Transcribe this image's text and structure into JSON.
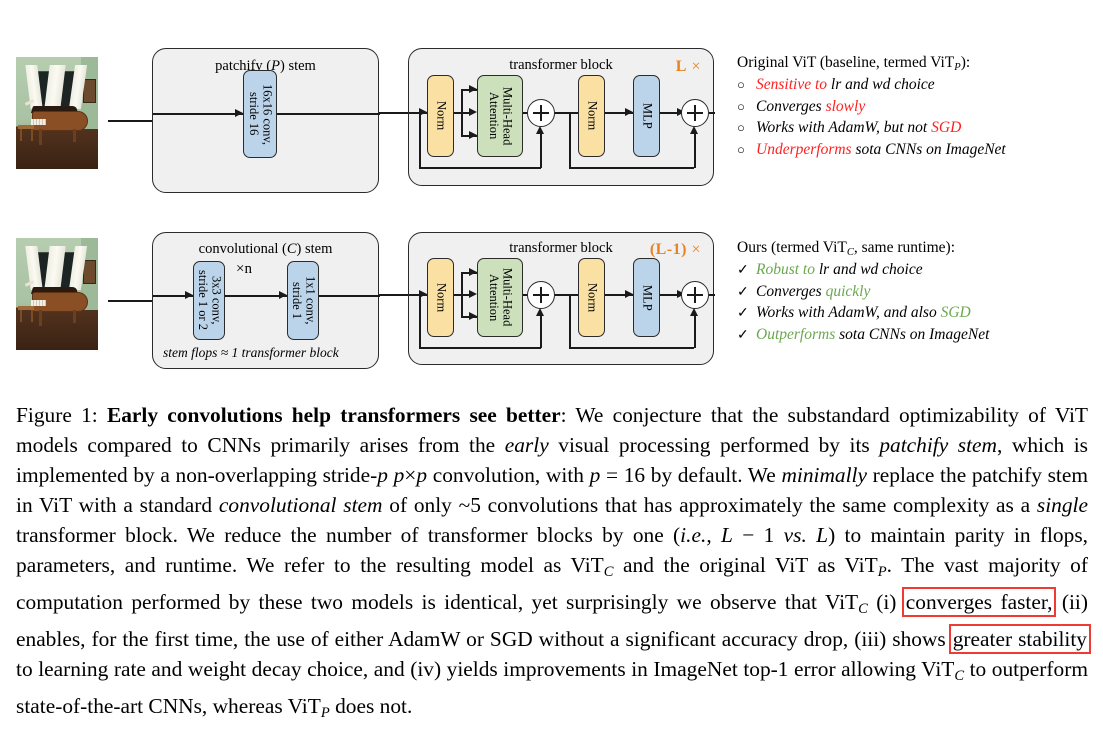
{
  "figure": {
    "rows": [
      {
        "id": "row-original",
        "stem": {
          "title_pre": "patchify (",
          "title_sym": "P",
          "title_post": ") stem",
          "blocks": [
            {
              "label": "16x16 conv,\nstride 16"
            }
          ]
        },
        "transformer": {
          "title": "transformer block",
          "repeat": "L",
          "repeat_x": "×",
          "nodes": [
            "Norm",
            "Multi-Head\nAttention",
            "+",
            "Norm",
            "MLP",
            "+"
          ]
        },
        "panel": {
          "head_pre": "Original ViT (baseline, termed ViT",
          "head_sub": "P",
          "head_post": "):",
          "marker": "○",
          "bullets": [
            {
              "parts": [
                {
                  "t": "Sensitive to",
                  "c": "red"
                },
                {
                  "t": " lr and wd choice",
                  "c": "black"
                }
              ]
            },
            {
              "parts": [
                {
                  "t": "Converges ",
                  "c": "black"
                },
                {
                  "t": "slowly",
                  "c": "red"
                }
              ]
            },
            {
              "parts": [
                {
                  "t": "Works with AdamW, but not ",
                  "c": "black"
                },
                {
                  "t": "SGD",
                  "c": "red"
                }
              ]
            },
            {
              "parts": [
                {
                  "t": "Underperforms",
                  "c": "red"
                },
                {
                  "t": " sota CNNs on ImageNet",
                  "c": "black"
                }
              ]
            }
          ]
        }
      },
      {
        "id": "row-ours",
        "stem": {
          "title_pre": "convolutional (",
          "title_sym": "C",
          "title_post": ") stem",
          "blocks": [
            {
              "label": "3x3 conv,\nstride 1 or 2"
            },
            {
              "label": "1x1 conv,\nstride 1"
            }
          ],
          "multiplier": "×n",
          "note": "stem flops ≈ 1 transformer block"
        },
        "transformer": {
          "title": "transformer block",
          "repeat": "(L-1)",
          "repeat_x": "×",
          "nodes": [
            "Norm",
            "Multi-Head\nAttention",
            "+",
            "Norm",
            "MLP",
            "+"
          ]
        },
        "panel": {
          "head_pre": "Ours (termed ViT",
          "head_sub": "C",
          "head_post": ", same runtime):",
          "marker": "✓",
          "bullets": [
            {
              "parts": [
                {
                  "t": "Robust to",
                  "c": "green"
                },
                {
                  "t": " lr and wd choice",
                  "c": "black"
                }
              ]
            },
            {
              "parts": [
                {
                  "t": "Converges ",
                  "c": "black"
                },
                {
                  "t": "quickly",
                  "c": "green"
                }
              ]
            },
            {
              "parts": [
                {
                  "t": "Works with AdamW, and also ",
                  "c": "black"
                },
                {
                  "t": "SGD",
                  "c": "green"
                }
              ]
            },
            {
              "parts": [
                {
                  "t": "Outperforms",
                  "c": "green"
                },
                {
                  "t": " sota CNNs on ImageNet",
                  "c": "black"
                }
              ]
            }
          ]
        }
      }
    ],
    "colors": {
      "conv_box": "#bbd4ea",
      "norm_box": "#fbe0a3",
      "attention_box": "#cbe0bb",
      "repeat_label": "#e8821e",
      "negative_text": "#ff2020",
      "positive_text": "#6aa84f",
      "highlight_box": "#ee3b33",
      "outer_fill": "#f0f0f0"
    }
  },
  "caption": {
    "label": "Figure 1:",
    "bold_title": "Early convolutions help transformers see better",
    "body": "We conjecture that the substandard optimizability of ViT models compared to CNNs primarily arises from the early visual processing performed by its patchify stem, which is implemented by a non-overlapping stride-p p×p convolution, with p = 16 by default. We minimally replace the patchify stem in ViT with a standard convolutional stem of only ~5 convolutions that has approximately the same complexity as a single transformer block. We reduce the number of transformer blocks by one (i.e., L − 1 vs. L) to maintain parity in flops, parameters, and runtime. We refer to the resulting model as ViT_C and the original ViT as ViT_P. The vast majority of computation performed by these two models is identical, yet surprisingly we observe that ViT_C (i) converges faster, (ii) enables, for the first time, the use of either AdamW or SGD without a significant accuracy drop, (iii) shows greater stability to learning rate and weight decay choice, and (iv) yields improvements in ImageNet top-1 error allowing ViT_C to outperform state-of-the-art CNNs, whereas ViT_P does not.",
    "highlighted_phrases": [
      "converges faster,",
      "greater stability"
    ]
  }
}
